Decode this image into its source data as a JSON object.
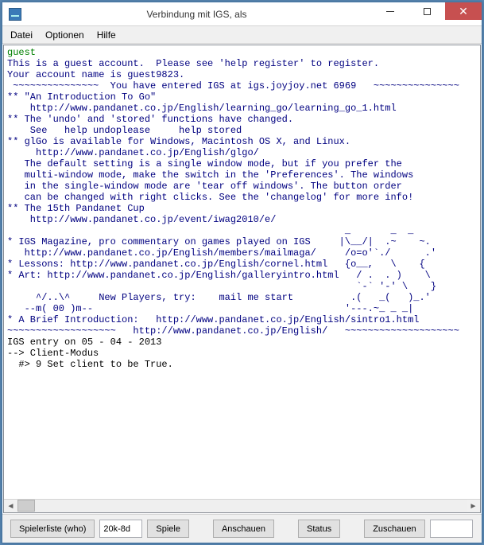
{
  "window": {
    "title": "Verbindung mit IGS, als"
  },
  "menu": {
    "file": "Datei",
    "options": "Optionen",
    "help": "Hilfe"
  },
  "terminal": {
    "guest": "guest",
    "l1": "This is a guest account.  Please see 'help register' to register.",
    "l2": "Your account name is guest9823.",
    "l3": " ~~~~~~~~~~~~~~~  You have entered IGS at igs.joyjoy.net 6969   ~~~~~~~~~~~~~~~",
    "l4": "** \"An Introduction To Go\"",
    "l5": "    http://www.pandanet.co.jp/English/learning_go/learning_go_1.html",
    "l6": "** The 'undo' and 'stored' functions have changed.",
    "l7": "    See   help undoplease     help stored",
    "l8": "** glGo is available for Windows, Macintosh OS X, and Linux.",
    "l9": "     http://www.pandanet.co.jp/English/glgo/",
    "l10": "   The default setting is a single window mode, but if you prefer the",
    "l11": "   multi-window mode, make the switch in the 'Preferences'. The windows",
    "l12": "   in the single-window mode are 'tear off windows'. The button order",
    "l13": "   can be changed with right clicks. See the 'changelog' for more info!",
    "l14": "** The 15th Pandanet Cup",
    "l15": "    http://www.pandanet.co.jp/event/iwag2010/e/",
    "l16": "                                                           _       _  _",
    "l17": "* IGS Magazine, pro commentary on games played on IGS     |\\__/|  .~    ~.",
    "l18": "   http://www.pandanet.co.jp/English/members/mailmaga/     /o=o'`./      .'",
    "l19": "* Lessons: http://www.pandanet.co.jp/English/cornel.html   {o__,   \\    {",
    "l20": "* Art: http://www.pandanet.co.jp/English/galleryintro.html   / .  . )    \\",
    "l21": "                                                             `-` '-' \\    }",
    "l22": "     ^/..\\^     New Players, try:    mail me start          .(   _(   )_.'",
    "l23": "   --m( 00 )m--                                            '---.~_ _ _|",
    "l24": "* A Brief Introduction:   http://www.pandanet.co.jp/English/sintro1.html",
    "l25": "~~~~~~~~~~~~~~~~~~~   http://www.pandanet.co.jp/English/   ~~~~~~~~~~~~~~~~~~~~",
    "l26": "IGS entry on 05 - 04 - 2013",
    "l27": "--> Client-Modus",
    "l28": "  #> 9 Set client to be True."
  },
  "buttons": {
    "playerlist": "Spielerliste (who)",
    "rank": "20k-8d",
    "games": "Spiele",
    "watch": "Anschauen",
    "status": "Status",
    "observe": "Zuschauen"
  }
}
